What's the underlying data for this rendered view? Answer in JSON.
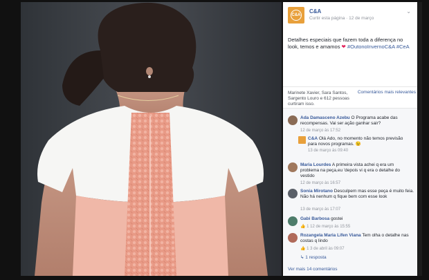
{
  "post": {
    "page_name": "C&A",
    "logo_text": "C&A",
    "meta": "Curtir esta página · 12 de março",
    "text_plain": "Detalhes especiais que fazem toda a diferença no look, temos e amamos",
    "heart": "❤",
    "hashtags": "#OutonoInvernoC&A #CeA",
    "likes_text": "Marinete Xavier, Sara Santos, Sargento Louro e 612 pessoas curtiram isso.",
    "sort_label": "Comentários mais relevantes"
  },
  "comments": [
    {
      "name": "Ada Damasceno Azebu",
      "text": "O Programa acabe das recompensas. Vai ser ação ganhar sair?",
      "date": "12 de março às 17:52"
    },
    {
      "reply": true,
      "name": "C&A",
      "text": "Olá Ado, no momento não temos previsão para novos programas. 😉",
      "date": "13 de março às 09:40"
    },
    {
      "name": "Maria Lourdes",
      "text": "A primeira vista achei q era um problema na peça,eu 'depois vi q era o detalhe do vestido",
      "date": "12 de março às 16:57"
    },
    {
      "name": "Sonia Mirotano",
      "text": "Desculpem mas esse peça é muito feia. Não há nenhum q fique bem com esse look",
      "date": "13 de março às 17:07"
    },
    {
      "name": "Gabi Barbosa",
      "text": "gostei",
      "date": "12 de março às 15:55",
      "reactions": "1"
    },
    {
      "name": "Rozangela Maria Lifen Viana",
      "text": "Tem olha o detalhe nas costas q lindo",
      "date": "3 de abril às 09:07",
      "reactions": "1",
      "replies": "1 resposta"
    }
  ],
  "more_comments": "Ver mais 14 comentários"
}
